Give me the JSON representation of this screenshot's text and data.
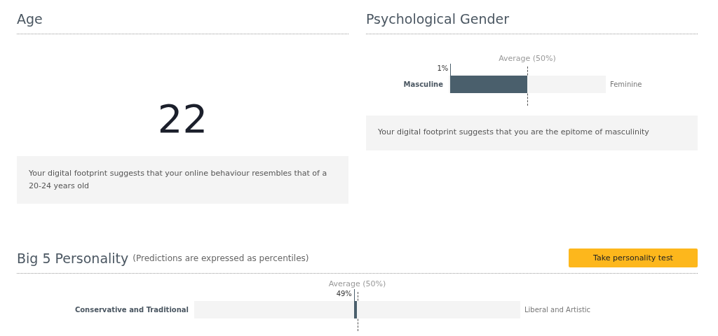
{
  "age": {
    "title": "Age",
    "value": "22",
    "description": "Your digital footprint suggests that your online behaviour resembles that of a 20-24 years old"
  },
  "gender": {
    "title": "Psychological Gender",
    "average_label": "Average (50%)",
    "left_label": "Masculine",
    "right_label": "Feminine",
    "level": 0.01,
    "reading": "1%",
    "description": "Your digital footprint suggests that you are the epitome of masculinity"
  },
  "personality": {
    "title": "Big 5 Personality",
    "subtitle": "(Predictions are expressed as percentiles)",
    "button": "Take personality test",
    "traits": [
      {
        "average_label": "Average (50%)",
        "left_label": "Conservative and Traditional",
        "right_label": "Liberal and Artistic",
        "level": 0.49,
        "reading": "49%"
      }
    ]
  }
}
